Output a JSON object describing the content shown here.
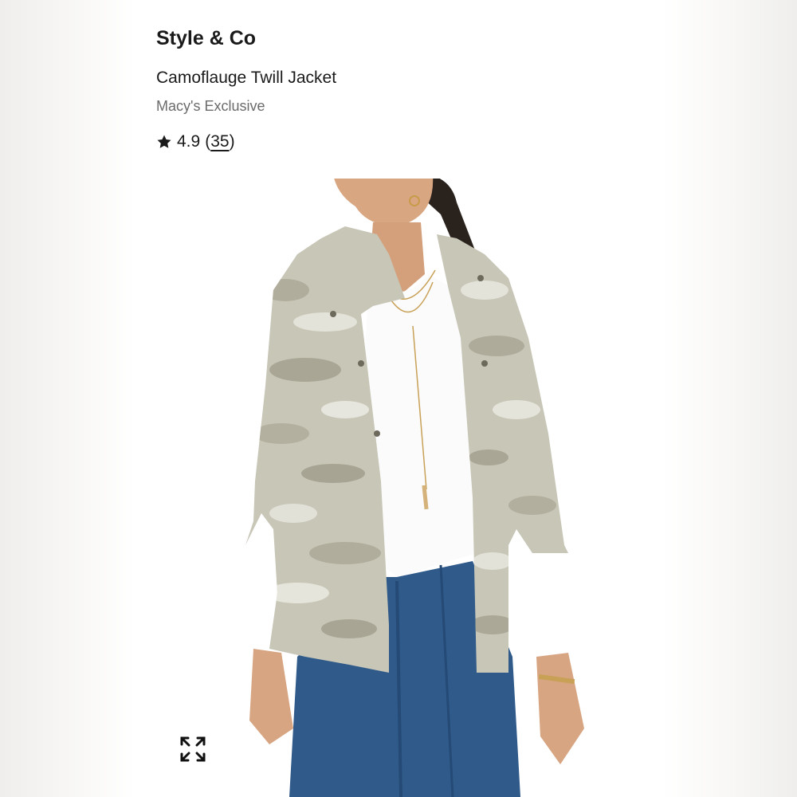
{
  "product": {
    "brand": "Style & Co",
    "name": "Camoflauge Twill Jacket",
    "exclusive": "Macy's Exclusive",
    "rating": "4.9",
    "review_count": "35"
  },
  "icons": {
    "rating": "star-icon",
    "expand": "expand-icon"
  },
  "colors": {
    "text": "#1a1a1a",
    "muted": "#6b6b6b",
    "background": "#ffffff"
  }
}
